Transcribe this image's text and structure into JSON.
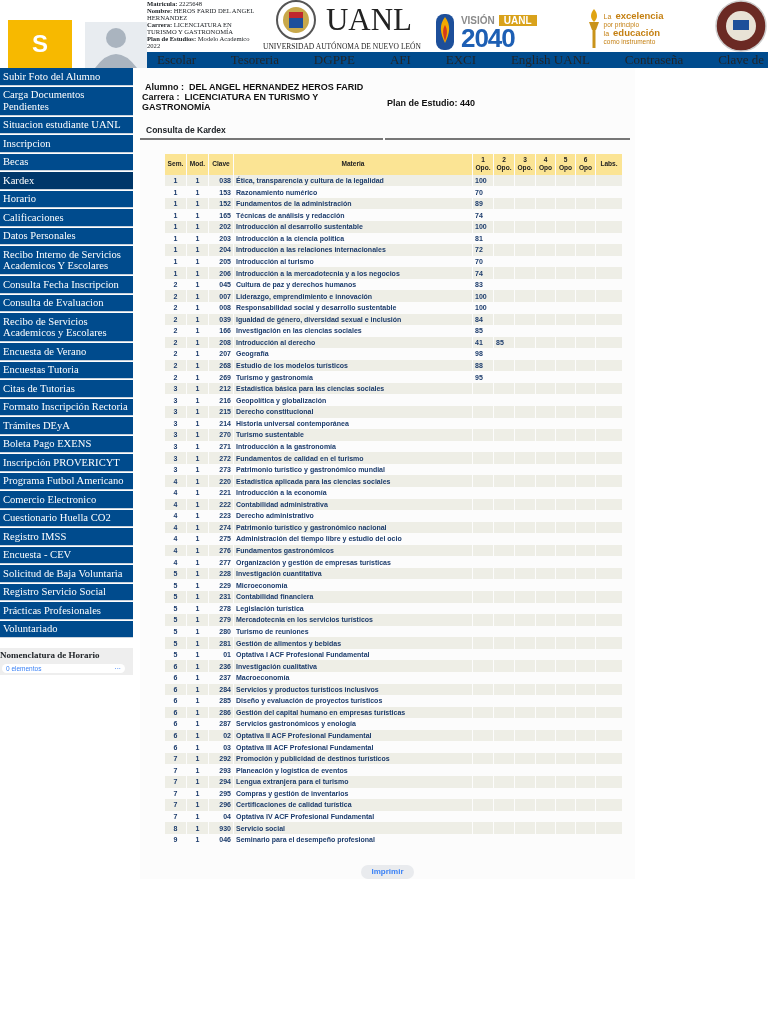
{
  "header": {
    "app_initial": "S",
    "student_info": [
      "**Matricula:** 2225648",
      "**Nombre:** HEROS FARID DEL ANGEL HERNANDEZ",
      "**Carrera:** LICENCIATURA EN TURISMO Y GASTRONOMÍA",
      "**Plan de Estudios:** Modelo Academico 2022"
    ],
    "university_name": "UANL",
    "university_full": "UNIVERSIDAD AUTÓNOMA DE NUEVO LEÓN",
    "vision": {
      "word": "VISIÓN",
      "badge": "UANL",
      "year": "2040"
    },
    "motto": [
      "La",
      "excelencia",
      "por principio",
      "la",
      "educación",
      "como instrumento"
    ]
  },
  "nav": [
    "Escolar",
    "Tesoreria",
    "DGPPE",
    "AFI",
    "EXCI",
    "English UANL",
    "Contraseña",
    "Clave de"
  ],
  "sidebar": {
    "items": [
      {
        "label": "Subir Foto del Alumno",
        "selected": false
      },
      {
        "label": "Carga Documentos Pendientes",
        "selected": false
      },
      {
        "label": "Situacion estudiante UANL",
        "selected": false
      },
      {
        "label": "Inscripcion",
        "selected": false
      },
      {
        "label": "Becas",
        "selected": false
      },
      {
        "label": "Kardex",
        "selected": true
      },
      {
        "label": "Horario",
        "selected": false
      },
      {
        "label": "Calificaciones",
        "selected": false
      },
      {
        "label": "Datos Personales",
        "selected": false
      },
      {
        "label": "Recibo Interno de Servicios Academicos Y Escolares",
        "selected": false
      },
      {
        "label": "Consulta Fecha Inscripcion",
        "selected": false
      },
      {
        "label": "Consulta de Evaluacion",
        "selected": false
      },
      {
        "label": "Recibo de Servicios Academicos y Escolares",
        "selected": false
      },
      {
        "label": "Encuesta de Verano",
        "selected": false
      },
      {
        "label": "Encuestas Tutoria",
        "selected": false
      },
      {
        "label": "Citas de Tutorias",
        "selected": false
      },
      {
        "label": "Formato Inscripción Rectoria",
        "selected": false
      },
      {
        "label": "Trámites DEyA",
        "selected": false
      },
      {
        "label": "Boleta Pago EXENS",
        "selected": false
      },
      {
        "label": "Inscripción PROVERICYT",
        "selected": false
      },
      {
        "label": "Programa Futbol Americano",
        "selected": false
      },
      {
        "label": "Comercio Electronico",
        "selected": false
      },
      {
        "label": "Cuestionario Huella CO2",
        "selected": false
      },
      {
        "label": "Registro IMSS",
        "selected": false
      },
      {
        "label": "Encuesta - CEV",
        "selected": false
      },
      {
        "label": "Solicitud de Baja Voluntaria",
        "selected": false
      },
      {
        "label": "Registro Servicio Social",
        "selected": false
      },
      {
        "label": "Prácticas Profesionales",
        "selected": false
      },
      {
        "label": "Voluntariado",
        "selected": false
      }
    ],
    "schedule_legend": {
      "title": "Nomenclatura de Horario",
      "count": "0 elementos",
      "more": "···"
    }
  },
  "student": {
    "alumno_label": "Alumno :",
    "alumno": "DEL ANGEL HERNANDEZ HEROS FARID",
    "carrera_label": "Carrera :",
    "carrera": "LICENCIATURA EN TURISMO Y GASTRONOMÍA",
    "plan": "Plan de Estudio: 440"
  },
  "section_title": "Consulta de Kardex",
  "table": {
    "columns": [
      "Sem.",
      "Mod.",
      "Clave",
      "Materia",
      "1 Opo.",
      "2 Opo.",
      "3 Opo.",
      "4 Opo",
      "5 Opo",
      "6 Opo",
      "Labs."
    ],
    "rows": [
      {
        "sem": "1",
        "mod": "1",
        "clave": "038",
        "materia": "Ética, transparencia y cultura de la legalidad",
        "grades": [
          "100"
        ]
      },
      {
        "sem": "1",
        "mod": "1",
        "clave": "153",
        "materia": "Razonamiento numérico",
        "grades": [
          "70"
        ]
      },
      {
        "sem": "1",
        "mod": "1",
        "clave": "152",
        "materia": "Fundamentos de la administración",
        "grades": [
          "89"
        ]
      },
      {
        "sem": "1",
        "mod": "1",
        "clave": "165",
        "materia": "Técnicas de análisis y redacción",
        "grades": [
          "74"
        ]
      },
      {
        "sem": "1",
        "mod": "1",
        "clave": "202",
        "materia": "Introducción al desarrollo sustentable",
        "grades": [
          "100"
        ]
      },
      {
        "sem": "1",
        "mod": "1",
        "clave": "203",
        "materia": "Introducción a la ciencia política",
        "grades": [
          "81"
        ]
      },
      {
        "sem": "1",
        "mod": "1",
        "clave": "204",
        "materia": "Introducción a las relaciones internacionales",
        "grades": [
          "72"
        ]
      },
      {
        "sem": "1",
        "mod": "1",
        "clave": "205",
        "materia": "Introducción al turismo",
        "grades": [
          "70"
        ]
      },
      {
        "sem": "1",
        "mod": "1",
        "clave": "206",
        "materia": "Introducción a la mercadotecnia y a los negocios",
        "grades": [
          "74"
        ]
      },
      {
        "sem": "2",
        "mod": "1",
        "clave": "045",
        "materia": "Cultura de paz y derechos humanos",
        "grades": [
          "83"
        ]
      },
      {
        "sem": "2",
        "mod": "1",
        "clave": "007",
        "materia": "Liderazgo, emprendimiento e innovación",
        "grades": [
          "100"
        ]
      },
      {
        "sem": "2",
        "mod": "1",
        "clave": "008",
        "materia": "Responsabilidad social y desarrollo sustentable",
        "grades": [
          "100"
        ]
      },
      {
        "sem": "2",
        "mod": "1",
        "clave": "039",
        "materia": "Igualdad de género, diversidad sexual e inclusión",
        "grades": [
          "84"
        ]
      },
      {
        "sem": "2",
        "mod": "1",
        "clave": "166",
        "materia": "Investigación en las ciencias sociales",
        "grades": [
          "85"
        ]
      },
      {
        "sem": "2",
        "mod": "1",
        "clave": "208",
        "materia": "Introducción al derecho",
        "grades": [
          "41",
          "85"
        ]
      },
      {
        "sem": "2",
        "mod": "1",
        "clave": "207",
        "materia": "Geografía",
        "grades": [
          "98"
        ]
      },
      {
        "sem": "2",
        "mod": "1",
        "clave": "268",
        "materia": "Estudio de los modelos turísticos",
        "grades": [
          "88"
        ]
      },
      {
        "sem": "2",
        "mod": "1",
        "clave": "269",
        "materia": "Turismo y gastronomía",
        "grades": [
          "95"
        ]
      },
      {
        "sem": "3",
        "mod": "1",
        "clave": "212",
        "materia": "Estadística básica para las ciencias sociales",
        "grades": []
      },
      {
        "sem": "3",
        "mod": "1",
        "clave": "216",
        "materia": "Geopolítica y globalización",
        "grades": []
      },
      {
        "sem": "3",
        "mod": "1",
        "clave": "215",
        "materia": "Derecho constitucional",
        "grades": []
      },
      {
        "sem": "3",
        "mod": "1",
        "clave": "214",
        "materia": "Historia universal contemporánea",
        "grades": []
      },
      {
        "sem": "3",
        "mod": "1",
        "clave": "270",
        "materia": "Turismo sustentable",
        "grades": []
      },
      {
        "sem": "3",
        "mod": "1",
        "clave": "271",
        "materia": "Introducción a la gastronomía",
        "grades": []
      },
      {
        "sem": "3",
        "mod": "1",
        "clave": "272",
        "materia": "Fundamentos de calidad en el turismo",
        "grades": []
      },
      {
        "sem": "3",
        "mod": "1",
        "clave": "273",
        "materia": "Patrimonio turístico y gastronómico mundial",
        "grades": []
      },
      {
        "sem": "4",
        "mod": "1",
        "clave": "220",
        "materia": "Estadística aplicada para las ciencias sociales",
        "grades": []
      },
      {
        "sem": "4",
        "mod": "1",
        "clave": "221",
        "materia": "Introducción a la economía",
        "grades": []
      },
      {
        "sem": "4",
        "mod": "1",
        "clave": "222",
        "materia": "Contabilidad administrativa",
        "grades": []
      },
      {
        "sem": "4",
        "mod": "1",
        "clave": "223",
        "materia": "Derecho administrativo",
        "grades": []
      },
      {
        "sem": "4",
        "mod": "1",
        "clave": "274",
        "materia": "Patrimonio turístico y gastronómico nacional",
        "grades": []
      },
      {
        "sem": "4",
        "mod": "1",
        "clave": "275",
        "materia": "Administración del tiempo libre y estudio del ocio",
        "grades": []
      },
      {
        "sem": "4",
        "mod": "1",
        "clave": "276",
        "materia": "Fundamentos gastronómicos",
        "grades": []
      },
      {
        "sem": "4",
        "mod": "1",
        "clave": "277",
        "materia": "Organización y gestión de empresas turísticas",
        "grades": []
      },
      {
        "sem": "5",
        "mod": "1",
        "clave": "228",
        "materia": "Investigación cuantitativa",
        "grades": []
      },
      {
        "sem": "5",
        "mod": "1",
        "clave": "229",
        "materia": "Microeconomía",
        "grades": []
      },
      {
        "sem": "5",
        "mod": "1",
        "clave": "231",
        "materia": "Contabilidad financiera",
        "grades": []
      },
      {
        "sem": "5",
        "mod": "1",
        "clave": "278",
        "materia": "Legislación turística",
        "grades": []
      },
      {
        "sem": "5",
        "mod": "1",
        "clave": "279",
        "materia": "Mercadotecnia en los servicios turísticos",
        "grades": []
      },
      {
        "sem": "5",
        "mod": "1",
        "clave": "280",
        "materia": "Turismo de reuniones",
        "grades": []
      },
      {
        "sem": "5",
        "mod": "1",
        "clave": "281",
        "materia": "Gestión de alimentos y bebidas",
        "grades": []
      },
      {
        "sem": "5",
        "mod": "1",
        "clave": "01",
        "materia": "Optativa I ACF Profesional Fundamental",
        "grades": []
      },
      {
        "sem": "6",
        "mod": "1",
        "clave": "236",
        "materia": "Investigación cualitativa",
        "grades": []
      },
      {
        "sem": "6",
        "mod": "1",
        "clave": "237",
        "materia": "Macroeconomía",
        "grades": []
      },
      {
        "sem": "6",
        "mod": "1",
        "clave": "284",
        "materia": "Servicios y productos turísticos inclusivos",
        "grades": []
      },
      {
        "sem": "6",
        "mod": "1",
        "clave": "285",
        "materia": "Diseño y evaluación de proyectos turísticos",
        "grades": []
      },
      {
        "sem": "6",
        "mod": "1",
        "clave": "286",
        "materia": "Gestión del capital humano en empresas turísticas",
        "grades": []
      },
      {
        "sem": "6",
        "mod": "1",
        "clave": "287",
        "materia": "Servicios gastronómicos y enología",
        "grades": []
      },
      {
        "sem": "6",
        "mod": "1",
        "clave": "02",
        "materia": "Optativa II ACF Profesional Fundamental",
        "grades": []
      },
      {
        "sem": "6",
        "mod": "1",
        "clave": "03",
        "materia": "Optativa III ACF Profesional Fundamental",
        "grades": []
      },
      {
        "sem": "7",
        "mod": "1",
        "clave": "292",
        "materia": "Promoción y publicidad de destinos turísticos",
        "grades": []
      },
      {
        "sem": "7",
        "mod": "1",
        "clave": "293",
        "materia": "Planeación y logística de eventos",
        "grades": []
      },
      {
        "sem": "7",
        "mod": "1",
        "clave": "294",
        "materia": "Lengua extranjera para el turismo",
        "grades": []
      },
      {
        "sem": "7",
        "mod": "1",
        "clave": "295",
        "materia": "Compras y gestión de inventarios",
        "grades": []
      },
      {
        "sem": "7",
        "mod": "1",
        "clave": "296",
        "materia": "Certificaciones de calidad turística",
        "grades": []
      },
      {
        "sem": "7",
        "mod": "1",
        "clave": "04",
        "materia": "Optativa IV ACF Profesional Fundamental",
        "grades": []
      },
      {
        "sem": "8",
        "mod": "1",
        "clave": "930",
        "materia": "Servicio social",
        "grades": []
      },
      {
        "sem": "9",
        "mod": "1",
        "clave": "046",
        "materia": "Seminario para el desempeño profesional",
        "grades": []
      }
    ]
  },
  "print_button": "Imprimir"
}
